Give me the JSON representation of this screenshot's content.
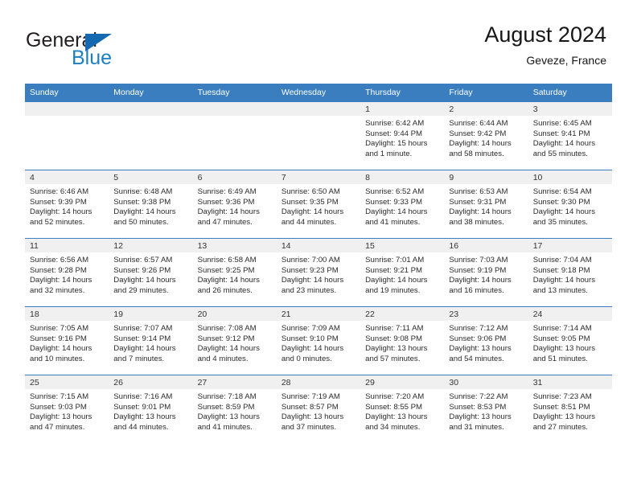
{
  "brand": {
    "line1": "General",
    "line2": "Blue",
    "flag_icon": "triangle-flag-icon"
  },
  "header": {
    "title": "August 2024",
    "subtitle": "Geveze, France"
  },
  "colors": {
    "header_blue": "#3a7ebf",
    "brand_blue": "#1c7fc4",
    "daynum_bg": "#f0f0f0"
  },
  "weekday_headers": [
    "Sunday",
    "Monday",
    "Tuesday",
    "Wednesday",
    "Thursday",
    "Friday",
    "Saturday"
  ],
  "labels": {
    "sunrise": "Sunrise:",
    "sunset": "Sunset:",
    "daylight": "Daylight:"
  },
  "weeks": [
    [
      {
        "day": "",
        "sunrise": "",
        "sunset": "",
        "daylight_line1": "",
        "daylight_line2": "",
        "empty": true
      },
      {
        "day": "",
        "sunrise": "",
        "sunset": "",
        "daylight_line1": "",
        "daylight_line2": "",
        "empty": true
      },
      {
        "day": "",
        "sunrise": "",
        "sunset": "",
        "daylight_line1": "",
        "daylight_line2": "",
        "empty": true
      },
      {
        "day": "",
        "sunrise": "",
        "sunset": "",
        "daylight_line1": "",
        "daylight_line2": "",
        "empty": true
      },
      {
        "day": "1",
        "sunrise": "Sunrise: 6:42 AM",
        "sunset": "Sunset: 9:44 PM",
        "daylight_line1": "Daylight: 15 hours",
        "daylight_line2": "and 1 minute."
      },
      {
        "day": "2",
        "sunrise": "Sunrise: 6:44 AM",
        "sunset": "Sunset: 9:42 PM",
        "daylight_line1": "Daylight: 14 hours",
        "daylight_line2": "and 58 minutes."
      },
      {
        "day": "3",
        "sunrise": "Sunrise: 6:45 AM",
        "sunset": "Sunset: 9:41 PM",
        "daylight_line1": "Daylight: 14 hours",
        "daylight_line2": "and 55 minutes."
      }
    ],
    [
      {
        "day": "4",
        "sunrise": "Sunrise: 6:46 AM",
        "sunset": "Sunset: 9:39 PM",
        "daylight_line1": "Daylight: 14 hours",
        "daylight_line2": "and 52 minutes."
      },
      {
        "day": "5",
        "sunrise": "Sunrise: 6:48 AM",
        "sunset": "Sunset: 9:38 PM",
        "daylight_line1": "Daylight: 14 hours",
        "daylight_line2": "and 50 minutes."
      },
      {
        "day": "6",
        "sunrise": "Sunrise: 6:49 AM",
        "sunset": "Sunset: 9:36 PM",
        "daylight_line1": "Daylight: 14 hours",
        "daylight_line2": "and 47 minutes."
      },
      {
        "day": "7",
        "sunrise": "Sunrise: 6:50 AM",
        "sunset": "Sunset: 9:35 PM",
        "daylight_line1": "Daylight: 14 hours",
        "daylight_line2": "and 44 minutes."
      },
      {
        "day": "8",
        "sunrise": "Sunrise: 6:52 AM",
        "sunset": "Sunset: 9:33 PM",
        "daylight_line1": "Daylight: 14 hours",
        "daylight_line2": "and 41 minutes."
      },
      {
        "day": "9",
        "sunrise": "Sunrise: 6:53 AM",
        "sunset": "Sunset: 9:31 PM",
        "daylight_line1": "Daylight: 14 hours",
        "daylight_line2": "and 38 minutes."
      },
      {
        "day": "10",
        "sunrise": "Sunrise: 6:54 AM",
        "sunset": "Sunset: 9:30 PM",
        "daylight_line1": "Daylight: 14 hours",
        "daylight_line2": "and 35 minutes."
      }
    ],
    [
      {
        "day": "11",
        "sunrise": "Sunrise: 6:56 AM",
        "sunset": "Sunset: 9:28 PM",
        "daylight_line1": "Daylight: 14 hours",
        "daylight_line2": "and 32 minutes."
      },
      {
        "day": "12",
        "sunrise": "Sunrise: 6:57 AM",
        "sunset": "Sunset: 9:26 PM",
        "daylight_line1": "Daylight: 14 hours",
        "daylight_line2": "and 29 minutes."
      },
      {
        "day": "13",
        "sunrise": "Sunrise: 6:58 AM",
        "sunset": "Sunset: 9:25 PM",
        "daylight_line1": "Daylight: 14 hours",
        "daylight_line2": "and 26 minutes."
      },
      {
        "day": "14",
        "sunrise": "Sunrise: 7:00 AM",
        "sunset": "Sunset: 9:23 PM",
        "daylight_line1": "Daylight: 14 hours",
        "daylight_line2": "and 23 minutes."
      },
      {
        "day": "15",
        "sunrise": "Sunrise: 7:01 AM",
        "sunset": "Sunset: 9:21 PM",
        "daylight_line1": "Daylight: 14 hours",
        "daylight_line2": "and 19 minutes."
      },
      {
        "day": "16",
        "sunrise": "Sunrise: 7:03 AM",
        "sunset": "Sunset: 9:19 PM",
        "daylight_line1": "Daylight: 14 hours",
        "daylight_line2": "and 16 minutes."
      },
      {
        "day": "17",
        "sunrise": "Sunrise: 7:04 AM",
        "sunset": "Sunset: 9:18 PM",
        "daylight_line1": "Daylight: 14 hours",
        "daylight_line2": "and 13 minutes."
      }
    ],
    [
      {
        "day": "18",
        "sunrise": "Sunrise: 7:05 AM",
        "sunset": "Sunset: 9:16 PM",
        "daylight_line1": "Daylight: 14 hours",
        "daylight_line2": "and 10 minutes."
      },
      {
        "day": "19",
        "sunrise": "Sunrise: 7:07 AM",
        "sunset": "Sunset: 9:14 PM",
        "daylight_line1": "Daylight: 14 hours",
        "daylight_line2": "and 7 minutes."
      },
      {
        "day": "20",
        "sunrise": "Sunrise: 7:08 AM",
        "sunset": "Sunset: 9:12 PM",
        "daylight_line1": "Daylight: 14 hours",
        "daylight_line2": "and 4 minutes."
      },
      {
        "day": "21",
        "sunrise": "Sunrise: 7:09 AM",
        "sunset": "Sunset: 9:10 PM",
        "daylight_line1": "Daylight: 14 hours",
        "daylight_line2": "and 0 minutes."
      },
      {
        "day": "22",
        "sunrise": "Sunrise: 7:11 AM",
        "sunset": "Sunset: 9:08 PM",
        "daylight_line1": "Daylight: 13 hours",
        "daylight_line2": "and 57 minutes."
      },
      {
        "day": "23",
        "sunrise": "Sunrise: 7:12 AM",
        "sunset": "Sunset: 9:06 PM",
        "daylight_line1": "Daylight: 13 hours",
        "daylight_line2": "and 54 minutes."
      },
      {
        "day": "24",
        "sunrise": "Sunrise: 7:14 AM",
        "sunset": "Sunset: 9:05 PM",
        "daylight_line1": "Daylight: 13 hours",
        "daylight_line2": "and 51 minutes."
      }
    ],
    [
      {
        "day": "25",
        "sunrise": "Sunrise: 7:15 AM",
        "sunset": "Sunset: 9:03 PM",
        "daylight_line1": "Daylight: 13 hours",
        "daylight_line2": "and 47 minutes."
      },
      {
        "day": "26",
        "sunrise": "Sunrise: 7:16 AM",
        "sunset": "Sunset: 9:01 PM",
        "daylight_line1": "Daylight: 13 hours",
        "daylight_line2": "and 44 minutes."
      },
      {
        "day": "27",
        "sunrise": "Sunrise: 7:18 AM",
        "sunset": "Sunset: 8:59 PM",
        "daylight_line1": "Daylight: 13 hours",
        "daylight_line2": "and 41 minutes."
      },
      {
        "day": "28",
        "sunrise": "Sunrise: 7:19 AM",
        "sunset": "Sunset: 8:57 PM",
        "daylight_line1": "Daylight: 13 hours",
        "daylight_line2": "and 37 minutes."
      },
      {
        "day": "29",
        "sunrise": "Sunrise: 7:20 AM",
        "sunset": "Sunset: 8:55 PM",
        "daylight_line1": "Daylight: 13 hours",
        "daylight_line2": "and 34 minutes."
      },
      {
        "day": "30",
        "sunrise": "Sunrise: 7:22 AM",
        "sunset": "Sunset: 8:53 PM",
        "daylight_line1": "Daylight: 13 hours",
        "daylight_line2": "and 31 minutes."
      },
      {
        "day": "31",
        "sunrise": "Sunrise: 7:23 AM",
        "sunset": "Sunset: 8:51 PM",
        "daylight_line1": "Daylight: 13 hours",
        "daylight_line2": "and 27 minutes."
      }
    ]
  ]
}
